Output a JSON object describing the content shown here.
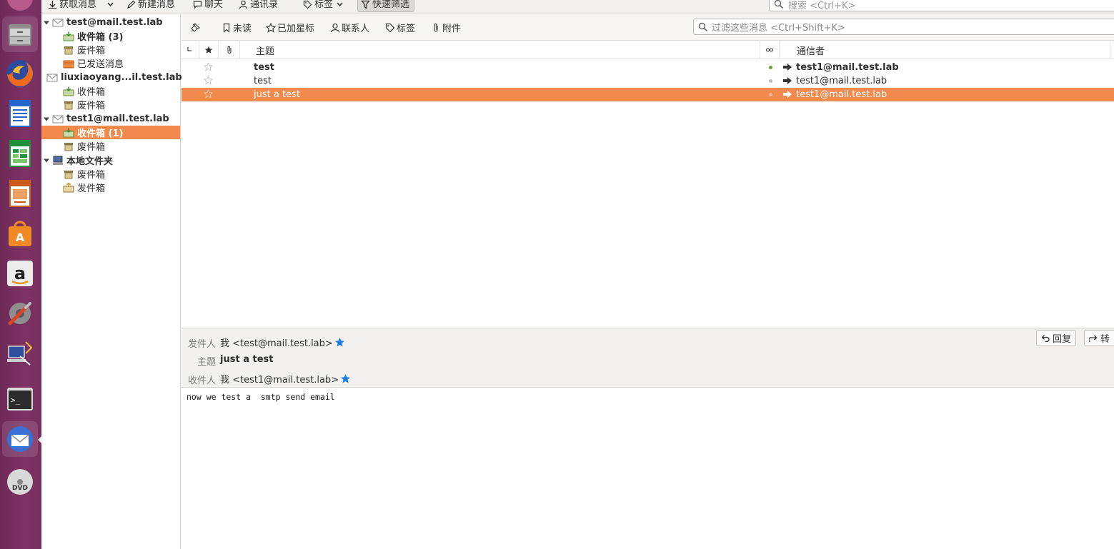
{
  "toolbar": {
    "get_messages": "获取消息",
    "new_message": "新建消息",
    "chat": "聊天",
    "address_book": "通讯录",
    "tag": "标签",
    "quick_filter": "快速筛选",
    "search_placeholder": "搜索 <Ctrl+K>"
  },
  "folders": {
    "account1": {
      "name": "test@mail.test.lab",
      "inbox": "收件箱 (3)",
      "trash": "废件箱",
      "sent": "已发送消息"
    },
    "account2": {
      "name": "liuxiaoyang...il.test.lab",
      "inbox": "收件箱",
      "trash": "废件箱"
    },
    "account3": {
      "name": "test1@mail.test.lab",
      "inbox": "收件箱 (1)",
      "trash": "废件箱"
    },
    "local": {
      "name": "本地文件夹",
      "trash": "废件箱",
      "outbox": "发件箱"
    }
  },
  "quickfilter": {
    "unread": "未读",
    "starred": "已加星标",
    "contact": "联系人",
    "tags": "标签",
    "attachment": "附件",
    "filter_placeholder": "过滤这些消息 <Ctrl+Shift+K>"
  },
  "columns": {
    "subject": "主题",
    "correspondent": "通信者"
  },
  "messages": [
    {
      "subject": "test",
      "correspondent": "test1@mail.test.lab",
      "unread": true
    },
    {
      "subject": "test",
      "correspondent": "test1@mail.test.lab",
      "unread": false
    },
    {
      "subject": "just a test",
      "correspondent": "test1@mail.test.lab",
      "unread": false,
      "selected": true
    }
  ],
  "preview": {
    "from_label": "发件人",
    "from_value": "我 <test@mail.test.lab>",
    "subject_label": "主题",
    "subject_value": "just a test",
    "to_label": "收件人",
    "to_value": "我 <test1@mail.test.lab>",
    "reply_label": "回复",
    "forward_label": "转",
    "body": "now we test a  smtp send email"
  },
  "colors": {
    "selection": "#f2894d",
    "launcher": "#7a2f5e",
    "star_blue": "#1f7fe0"
  }
}
